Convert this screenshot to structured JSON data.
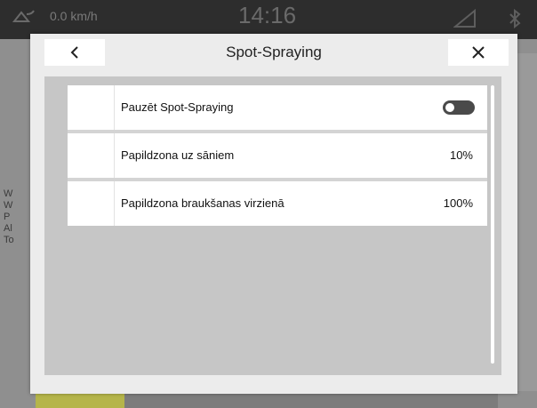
{
  "status_bar": {
    "speed": "0.0 km/h",
    "clock": "14:16"
  },
  "background": {
    "side_text": [
      "W",
      "W",
      "P",
      "Al",
      "To"
    ]
  },
  "dialog": {
    "title": "Spot-Spraying",
    "back_icon": "chevron-left-icon",
    "close_icon": "close-icon",
    "rows": [
      {
        "label": "Pauzēt Spot-Spraying",
        "control": "toggle",
        "toggle_state": "off"
      },
      {
        "label": "Papildzona uz sāniem",
        "value": "10%"
      },
      {
        "label": "Papildzona braukšanas virzienā",
        "value": "100%"
      }
    ]
  },
  "colors": {
    "status_bar": "#2d2d2d",
    "dialog_bg": "#ececec",
    "content_bg": "#c6c6c6",
    "toggle_bg": "#4a4a4a"
  }
}
